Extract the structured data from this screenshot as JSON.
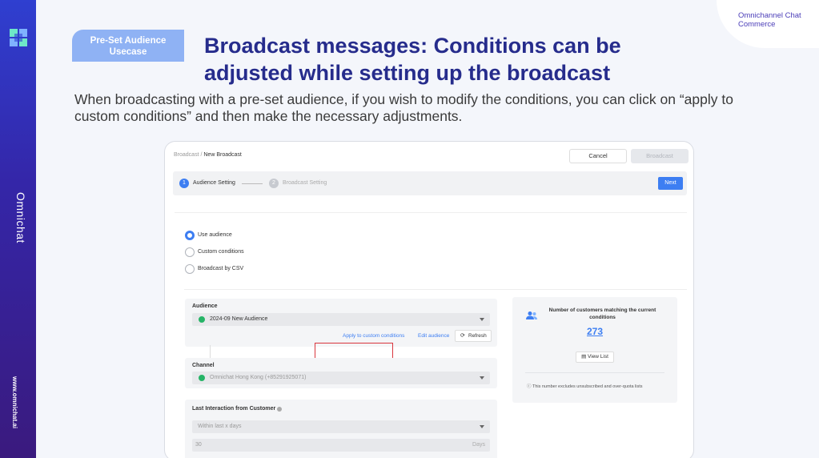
{
  "slide": {
    "tag": "Pre-Set Audience Usecase",
    "title": "Broadcast messages: Conditions can be adjusted while setting up the broadcast",
    "description": "When broadcasting with a pre-set audience, if you wish to modify the conditions, you can click on  “apply to custom conditions” and then make the necessary adjustments.",
    "corner_label": "Omnichannel Chat Commerce",
    "side_brand": "Omnichat",
    "side_website": "www.omnichat.ai"
  },
  "colors": {
    "accent": "#3d7ef2",
    "title": "#262c8c",
    "highlight": "#d9363e",
    "tag": "#8fb2f4"
  },
  "app": {
    "breadcrumb_parent": "Broadcast",
    "breadcrumb_sep": " / ",
    "breadcrumb_current": "New Broadcast",
    "cancel_label": "Cancel",
    "broadcast_label": "Broadcast",
    "steps": [
      {
        "num": "1",
        "label": "Audience Setting",
        "active": true
      },
      {
        "num": "2",
        "label": "Broadcast Setting",
        "active": false
      }
    ],
    "next_label": "Next",
    "audience_options": [
      {
        "label": "Use audience",
        "selected": true
      },
      {
        "label": "Custom conditions",
        "selected": false
      },
      {
        "label": "Broadcast by CSV",
        "selected": false
      }
    ],
    "audience": {
      "label": "Audience",
      "value": "2024-09 New Audience",
      "apply_link": "Apply to custom conditions",
      "edit_link": "Edit audience",
      "refresh_label": "Refresh"
    },
    "channel": {
      "label": "Channel",
      "value": "Omnichat Hong Kong (+85291925071)"
    },
    "last_interaction": {
      "label": "Last Interaction from Customer",
      "select_value": "Within last x days",
      "days_value": "30",
      "days_unit": "Days"
    },
    "match_card": {
      "title": "Number of customers matching the current conditions",
      "count": "273",
      "view_list_label": "View List",
      "note": "This number excludes unsubscribed and over-quota lists"
    },
    "icons": [
      "people-icon",
      "refresh-icon",
      "info-icon",
      "list-icon",
      "channel-status-icon"
    ]
  }
}
